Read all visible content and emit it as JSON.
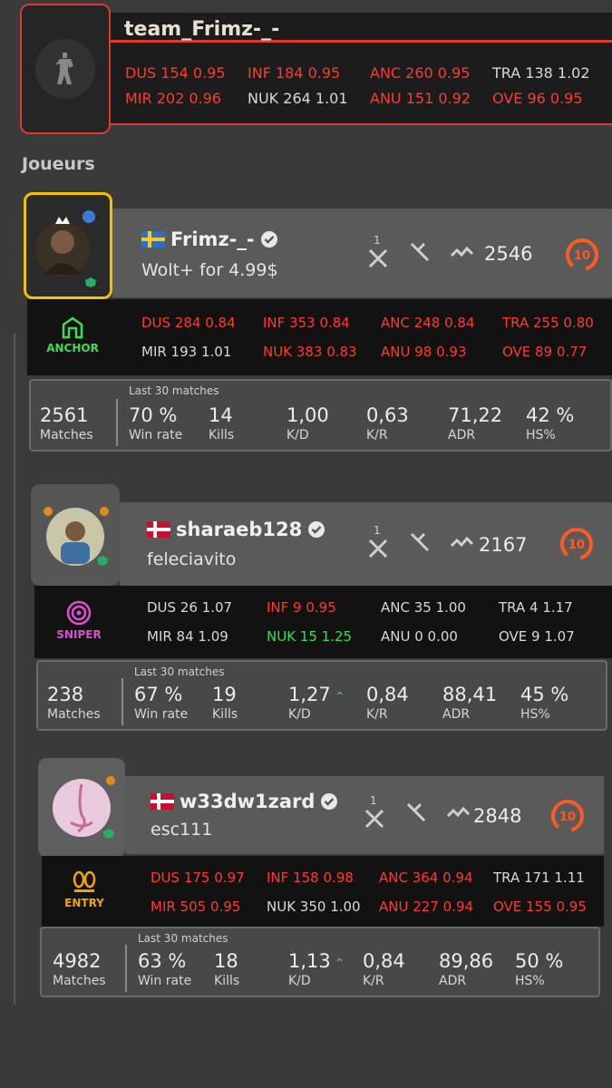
{
  "team": {
    "name": "team_Frimz-_-",
    "maps_row1": [
      "DUS 154  0.95",
      "INF  184  0.95",
      "ANC  260  0.95",
      "TRA  138  1.02"
    ],
    "maps_row2": [
      "MIR  202  0.96",
      "NUK  264  1.01",
      "ANU  151  0.92",
      "OVE   96  0.95"
    ]
  },
  "section_title": "Joueurs",
  "labels": {
    "last30": "Last 30 matches",
    "matches": "Matches",
    "winrate": "Win rate",
    "kills": "Kills",
    "kd": "K/D",
    "kr": "K/R",
    "adr": "ADR",
    "hs": "HS%",
    "matches_count_icon": "1"
  },
  "players": [
    {
      "name": "Frimz-_-",
      "subtitle": "Wolt+ for 4.99$",
      "elo": "2546",
      "level": "10",
      "role": "ANCHOR",
      "flag": "sweden",
      "maps_row1": [
        "DUS 284 0.84",
        "INF  353 0.84",
        "ANC 248 0.84",
        "TRA 255 0.80"
      ],
      "maps_row2": [
        "MIR  193 1.01",
        "NUK 383 0.83",
        "ANU  98 0.93",
        "OVE  89  0.77"
      ],
      "stats": {
        "matches": "2561",
        "winrate": "70 %",
        "kills": "14",
        "kd": "1,00",
        "kr": "0,63",
        "adr": "71,22",
        "hs": "42 %"
      }
    },
    {
      "name": "sharaeb128",
      "subtitle": "feleciavito",
      "elo": "2167",
      "level": "10",
      "role": "SNIPER",
      "flag": "denmark",
      "maps_row1": [
        "DUS   26   1.07",
        "INF    9   0.95",
        "ANC   35  1.00",
        "TRA    4    1.17"
      ],
      "maps_row2": [
        "MIR   84   1.09",
        "NUK   15   1.25",
        "ANU    0   0.00",
        "OVE    9    1.07"
      ],
      "stats": {
        "matches": "238",
        "winrate": "67 %",
        "kills": "19",
        "kd": "1,27",
        "kr": "0,84",
        "adr": "88,41",
        "hs": "45 %"
      }
    },
    {
      "name": "w33dw1zard",
      "subtitle": "esc111",
      "elo": "2848",
      "level": "10",
      "role": "ENTRY",
      "flag": "denmark",
      "maps_row1": [
        "DUS 175 0.97",
        "INF  158 0.98",
        "ANC 364 0.94",
        "TRA 171 1.11"
      ],
      "maps_row2": [
        "MIR 505 0.95",
        "NUK 350 1.00",
        "ANU 227 0.94",
        "OVE 155 0.95"
      ],
      "stats": {
        "matches": "4982",
        "winrate": "63 %",
        "kills": "18",
        "kd": "1,13",
        "kr": "0,84",
        "adr": "89,86",
        "hs": "50 %"
      }
    }
  ],
  "colors": {
    "accent": "#e03a2e",
    "gold": "#f2c200",
    "level": "#ff5a1f"
  }
}
